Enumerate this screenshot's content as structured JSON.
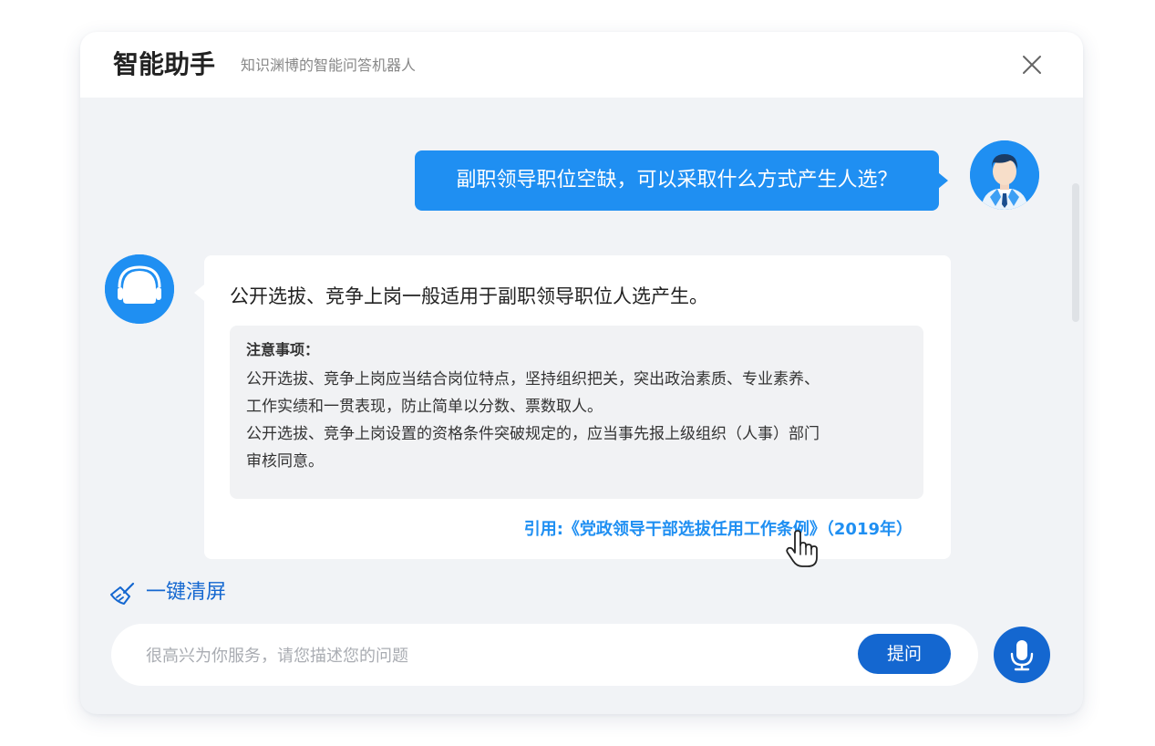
{
  "header": {
    "title": "智能助手",
    "subtitle": "知识渊博的智能问答机器人",
    "close_icon": "close-icon"
  },
  "messages": {
    "user": {
      "text": "副职领导职位空缺，可以采取什么方式产生人选？",
      "avatar_icon": "user-avatar-icon"
    },
    "bot": {
      "avatar_icon": "headset-icon",
      "main_text": "公开选拔、竞争上岗一般适用于副职领导职位人选产生。",
      "note": {
        "title": "注意事项：",
        "lines": [
          "公开选拔、竞争上岗应当结合岗位特点，坚持组织把关，突出政治素质、专业素养、",
          "工作实绩和一贯表现，防止简单以分数、票数取人。",
          "公开选拔、竞争上岗设置的资格条件突破规定的，应当事先报上级组织（人事）部门",
          "审核同意。"
        ]
      },
      "citation": "引用:《党政领导干部选拔任用工作条例》（2019年）"
    }
  },
  "actions": {
    "clear_label": "一键清屏",
    "clear_icon": "broom-icon"
  },
  "input": {
    "placeholder": "很高兴为你服务，请您描述您的问题",
    "value": "",
    "submit_label": "提问",
    "mic_icon": "microphone-icon"
  },
  "colors": {
    "accent": "#1f8ff2",
    "accent_dark": "#1467d0",
    "panel_bg": "#f1f3f6"
  }
}
